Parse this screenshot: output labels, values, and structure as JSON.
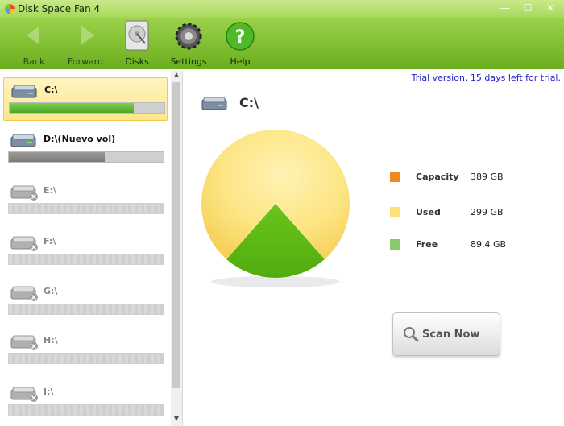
{
  "window": {
    "title": "Disk Space Fan 4"
  },
  "toolbar": {
    "back": "Back",
    "forward": "Forward",
    "disks": "Disks",
    "settings": "Settings",
    "help": "Help"
  },
  "drives": [
    {
      "label": "C:\\",
      "used_fraction": 0.8,
      "state": "selected"
    },
    {
      "label": "D:\\(Nuevo vol)",
      "used_fraction": 0.62,
      "state": "normal"
    },
    {
      "label": "E:\\",
      "state": "unavailable"
    },
    {
      "label": "F:\\",
      "state": "unavailable"
    },
    {
      "label": "G:\\",
      "state": "unavailable"
    },
    {
      "label": "H:\\",
      "state": "unavailable"
    },
    {
      "label": "I:\\",
      "state": "unavailable"
    }
  ],
  "main": {
    "trial_notice": "Trial version. 15 days left for trial.",
    "current_drive": "C:\\",
    "legend": [
      {
        "name": "Capacity",
        "value": "389 GB",
        "color": "#f08a1c"
      },
      {
        "name": "Used",
        "value": "299 GB",
        "color": "#fde27a"
      },
      {
        "name": "Free",
        "value": "89,4 GB",
        "color": "#8cc96a"
      }
    ],
    "scan_button": "Scan Now"
  },
  "chart_data": {
    "type": "pie",
    "slices": [
      {
        "name": "Used",
        "value": 299
      },
      {
        "name": "Free",
        "value": 89.4
      }
    ]
  }
}
